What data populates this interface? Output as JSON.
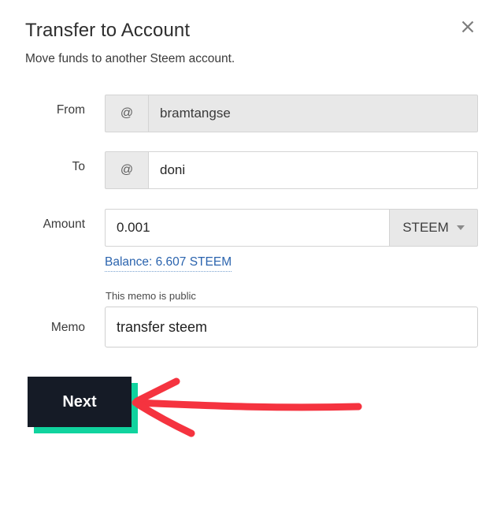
{
  "dialog": {
    "title": "Transfer to Account",
    "subtitle": "Move funds to another Steem account.",
    "close_icon": "close-icon"
  },
  "form": {
    "from": {
      "label": "From",
      "prefix": "@",
      "value": "bramtangse",
      "placeholder": "",
      "disabled": true
    },
    "to": {
      "label": "To",
      "prefix": "@",
      "value": "doni",
      "placeholder": "",
      "disabled": false
    },
    "amount": {
      "label": "Amount",
      "value": "0.001",
      "placeholder": "",
      "unit": "STEEM",
      "caret_icon": "chevron-down-icon",
      "balance_link": "Balance: 6.607 STEEM"
    },
    "memo": {
      "label": "Memo",
      "hint": "This memo is public",
      "value": "transfer steem",
      "placeholder": ""
    }
  },
  "actions": {
    "next_label": "Next"
  },
  "colors": {
    "accent_teal": "#10d39e",
    "button_dark": "#151b26",
    "link_blue": "#2b64ae",
    "annotation_red": "#f5333f"
  }
}
